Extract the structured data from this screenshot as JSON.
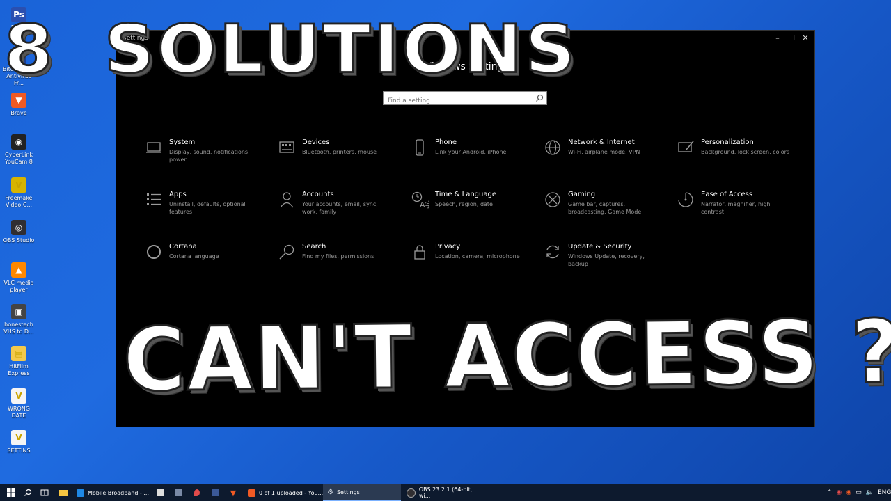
{
  "desktop": {
    "icons": [
      {
        "label": "Pho...",
        "color": "#2a4fb0",
        "glyph": "Ps"
      },
      {
        "label": "Bitdefender Antivirus Fr...",
        "color": "#1f3f8a",
        "glyph": "B"
      },
      {
        "label": "Brave",
        "color": "#f05a24",
        "glyph": "▼"
      },
      {
        "label": "CyberLink YouCam 8",
        "color": "#222222",
        "glyph": "◉"
      },
      {
        "label": "Freemake Video C...",
        "color": "#d7b400",
        "glyph": "V"
      },
      {
        "label": "OBS Studio",
        "color": "#302e31",
        "glyph": "◎"
      },
      {
        "label": "VLC media player",
        "color": "#ff8800",
        "glyph": "▲"
      },
      {
        "label": "honestech VHS to D...",
        "color": "#444444",
        "glyph": "▣"
      },
      {
        "label": "HitFilm Express",
        "color": "#f2c94c",
        "glyph": "▤"
      },
      {
        "label": "WRONG DATE",
        "color": "#f5f5f5",
        "glyph": "V"
      },
      {
        "label": "SETTINS",
        "color": "#f5f5f5",
        "glyph": "V"
      }
    ]
  },
  "window": {
    "title": "Settings",
    "heading": "Windows Settings",
    "search_placeholder": "Find a setting",
    "tiles": [
      {
        "name": "System",
        "desc": "Display, sound, notifications, power",
        "icon": "laptop-icon"
      },
      {
        "name": "Devices",
        "desc": "Bluetooth, printers, mouse",
        "icon": "keyboard-icon"
      },
      {
        "name": "Phone",
        "desc": "Link your Android, iPhone",
        "icon": "phone-icon"
      },
      {
        "name": "Network & Internet",
        "desc": "Wi-Fi, airplane mode, VPN",
        "icon": "globe-icon"
      },
      {
        "name": "Personalization",
        "desc": "Background, lock screen, colors",
        "icon": "paint-icon"
      },
      {
        "name": "Apps",
        "desc": "Uninstall, defaults, optional features",
        "icon": "apps-list-icon"
      },
      {
        "name": "Accounts",
        "desc": "Your accounts, email, sync, work, family",
        "icon": "person-icon"
      },
      {
        "name": "Time & Language",
        "desc": "Speech, region, date",
        "icon": "time-language-icon"
      },
      {
        "name": "Gaming",
        "desc": "Game bar, captures, broadcasting, Game Mode",
        "icon": "xbox-icon"
      },
      {
        "name": "Ease of Access",
        "desc": "Narrator, magnifier, high contrast",
        "icon": "ease-of-access-icon"
      },
      {
        "name": "Cortana",
        "desc": "Cortana language",
        "icon": "cortana-icon"
      },
      {
        "name": "Search",
        "desc": "Find my files, permissions",
        "icon": "search-icon"
      },
      {
        "name": "Privacy",
        "desc": "Location, camera, microphone",
        "icon": "lock-icon"
      },
      {
        "name": "Update & Security",
        "desc": "Windows Update, recovery, backup",
        "icon": "sync-icon"
      }
    ]
  },
  "overlay": {
    "top_a": "8",
    "top_b": "SOLUTIONS",
    "bottom": "CAN'T ACCESS ?"
  },
  "taskbar": {
    "apps": [
      {
        "label": "Mobile Broadband - ...",
        "color": "#1e88e5",
        "active": false
      },
      {
        "label": "0 of 1 uploaded - You...",
        "color": "#f05a24",
        "active": false
      },
      {
        "label": "Settings",
        "color": "#9aa4b2",
        "active": true
      },
      {
        "label": "OBS 23.2.1 (64-bit, wi...",
        "color": "#302e31",
        "active": false
      }
    ],
    "language": "ENG"
  }
}
